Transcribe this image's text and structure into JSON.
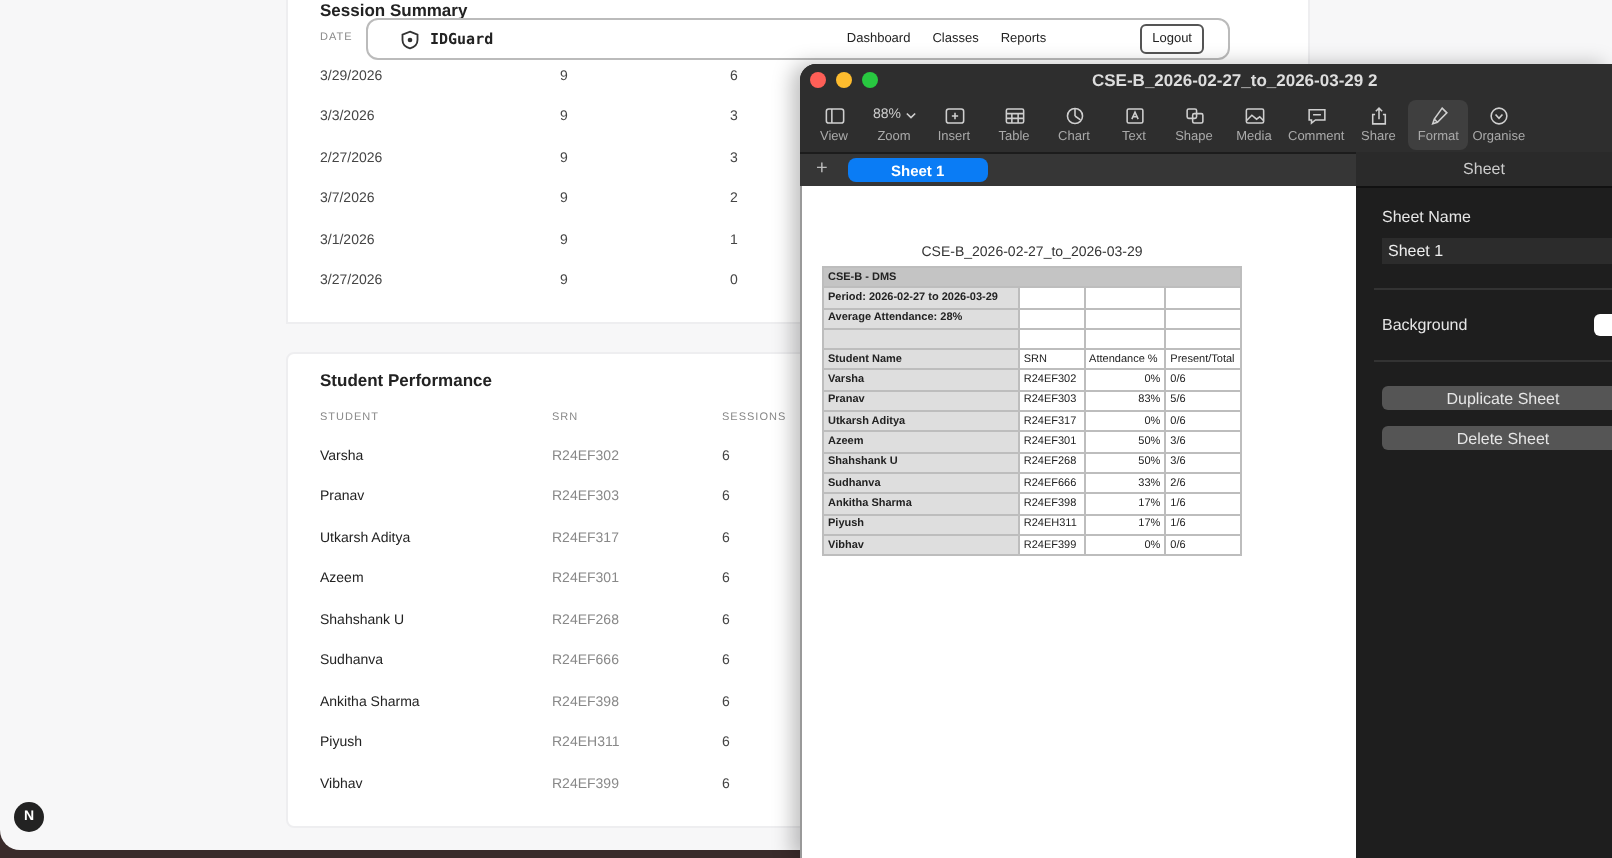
{
  "session_summary": {
    "title": "Session Summary",
    "columns": [
      "DATE"
    ],
    "rows": [
      {
        "date": "3/29/2026",
        "column_2": "9",
        "column_3": "6"
      },
      {
        "date": "3/3/2026",
        "column_2": "9",
        "column_3": "3"
      },
      {
        "date": "2/27/2026",
        "column_2": "9",
        "column_3": "3"
      },
      {
        "date": "3/7/2026",
        "column_2": "9",
        "column_3": "2"
      },
      {
        "date": "3/1/2026",
        "column_2": "9",
        "column_3": "1"
      },
      {
        "date": "3/27/2026",
        "column_2": "9",
        "column_3": "0"
      }
    ]
  },
  "navbar": {
    "brand": "IDGuard",
    "links": [
      "Dashboard",
      "Classes",
      "Reports"
    ],
    "button": "Logout"
  },
  "student_performance": {
    "title": "Student Performance",
    "columns": [
      "STUDENT",
      "SRN",
      "SESSIONS"
    ],
    "rows": [
      [
        "Varsha",
        "R24EF302",
        "6"
      ],
      [
        "Pranav",
        "R24EF303",
        "6"
      ],
      [
        "Utkarsh Aditya",
        "R24EF317",
        "6"
      ],
      [
        "Azeem",
        "R24EF301",
        "6"
      ],
      [
        "Shahshank U",
        "R24EF268",
        "6"
      ],
      [
        "Sudhanva",
        "R24EF666",
        "6"
      ],
      [
        "Ankitha Sharma",
        "R24EF398",
        "6"
      ],
      [
        "Piyush",
        "R24EH311",
        "6"
      ],
      [
        "Vibhav",
        "R24EF399",
        "6"
      ]
    ]
  },
  "numbers_window": {
    "title": "CSE-B_2026-02-27_to_2026-03-29 2",
    "toolbar": [
      {
        "kind": "icon",
        "label": "View",
        "selected": false
      },
      {
        "kind": "zoom",
        "label": "Zoom",
        "value": "88%",
        "selected": false
      },
      {
        "kind": "icon",
        "label": "Insert",
        "selected": false
      },
      {
        "kind": "icon",
        "label": "Table",
        "selected": false
      },
      {
        "kind": "icon",
        "label": "Chart",
        "selected": false
      },
      {
        "kind": "icon",
        "label": "Text",
        "selected": false
      },
      {
        "kind": "icon",
        "label": "Shape",
        "selected": false
      },
      {
        "kind": "icon",
        "label": "Media",
        "selected": false
      },
      {
        "kind": "icon",
        "label": "Comment",
        "selected": false
      },
      {
        "kind": "icon",
        "label": "Share",
        "selected": false
      },
      {
        "kind": "icon",
        "label": "Format",
        "selected": true
      },
      {
        "kind": "icon",
        "label": "Organise",
        "selected": false
      }
    ],
    "add_sheet": "+",
    "sheet_tabs": [
      {
        "label": "Sheet 1",
        "selected": true
      }
    ],
    "sheet": {
      "title": "CSE-B_2026-02-27_to_2026-03-29",
      "header": "CSE-B - DMS",
      "info": [
        "Period: 2026-02-27 to 2026-03-29",
        "Average Attendance: 28%"
      ],
      "columns": [
        "Student Name",
        "SRN",
        "Attendance %",
        "Present/Total"
      ],
      "rows": [
        [
          "Varsha",
          "R24EF302",
          "0%",
          "0/6"
        ],
        [
          "Pranav",
          "R24EF303",
          "83%",
          "5/6"
        ],
        [
          "Utkarsh Aditya",
          "R24EF317",
          "0%",
          "0/6"
        ],
        [
          "Azeem",
          "R24EF301",
          "50%",
          "3/6"
        ],
        [
          "Shahshank U",
          "R24EF268",
          "50%",
          "3/6"
        ],
        [
          "Sudhanva",
          "R24EF666",
          "33%",
          "2/6"
        ],
        [
          "Ankitha Sharma",
          "R24EF398",
          "17%",
          "1/6"
        ],
        [
          "Piyush",
          "R24EH311",
          "17%",
          "1/6"
        ],
        [
          "Vibhav",
          "R24EF399",
          "0%",
          "0/6"
        ]
      ]
    },
    "inspector": {
      "tab": "Sheet",
      "sheet_name_label": "Sheet Name",
      "sheet_name": "Sheet 1",
      "background_label": "Background",
      "buttons": [
        "Duplicate Sheet",
        "Delete Sheet"
      ]
    }
  },
  "dev_badge": "N"
}
